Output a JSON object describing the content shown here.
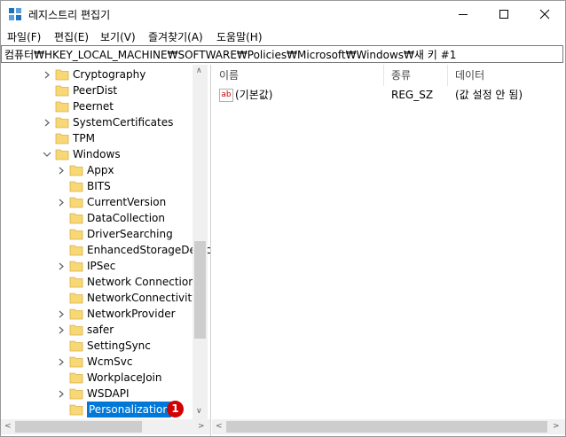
{
  "window": {
    "title": "레지스트리 편집기",
    "controls": [
      "minimize",
      "maximize",
      "close"
    ]
  },
  "menu": [
    {
      "label": "파일(F)"
    },
    {
      "label": "편집(E)"
    },
    {
      "label": "보기(V)"
    },
    {
      "label": "즐겨찾기(A)"
    },
    {
      "label": "도움말(H)"
    }
  ],
  "address": "컴퓨터₩HKEY_LOCAL_MACHINE₩SOFTWARE₩Policies₩Microsoft₩Windows₩새 키 #1",
  "tree": {
    "items": [
      {
        "label": "Cryptography",
        "level": 1,
        "expander": "collapsed"
      },
      {
        "label": "PeerDist",
        "level": 1,
        "expander": "none"
      },
      {
        "label": "Peernet",
        "level": 1,
        "expander": "none"
      },
      {
        "label": "SystemCertificates",
        "level": 1,
        "expander": "collapsed"
      },
      {
        "label": "TPM",
        "level": 1,
        "expander": "none"
      },
      {
        "label": "Windows",
        "level": 1,
        "expander": "expanded"
      },
      {
        "label": "Appx",
        "level": 2,
        "expander": "collapsed"
      },
      {
        "label": "BITS",
        "level": 2,
        "expander": "none"
      },
      {
        "label": "CurrentVersion",
        "level": 2,
        "expander": "collapsed"
      },
      {
        "label": "DataCollection",
        "level": 2,
        "expander": "none"
      },
      {
        "label": "DriverSearching",
        "level": 2,
        "expander": "none"
      },
      {
        "label": "EnhancedStorageDevic",
        "level": 2,
        "expander": "none"
      },
      {
        "label": "IPSec",
        "level": 2,
        "expander": "collapsed"
      },
      {
        "label": "Network Connections",
        "level": 2,
        "expander": "none"
      },
      {
        "label": "NetworkConnectivityS",
        "level": 2,
        "expander": "none"
      },
      {
        "label": "NetworkProvider",
        "level": 2,
        "expander": "collapsed"
      },
      {
        "label": "safer",
        "level": 2,
        "expander": "collapsed"
      },
      {
        "label": "SettingSync",
        "level": 2,
        "expander": "none"
      },
      {
        "label": "WcmSvc",
        "level": 2,
        "expander": "collapsed"
      },
      {
        "label": "WorkplaceJoin",
        "level": 2,
        "expander": "none"
      },
      {
        "label": "WSDAPI",
        "level": 2,
        "expander": "collapsed"
      },
      {
        "label": "Personalization",
        "level": 2,
        "expander": "none",
        "selected": true,
        "editing": true
      }
    ],
    "badge": "1"
  },
  "values": {
    "headers": {
      "name": "이름",
      "type": "종류",
      "data": "데이터"
    },
    "rows": [
      {
        "icon": "string-value-icon",
        "icon_text": "ab",
        "name": "(기본값)",
        "type": "REG_SZ",
        "data": "(값 설정 안 됨)"
      }
    ]
  },
  "colors": {
    "selection": "#0078d7",
    "folder": "#f8d775",
    "badge": "#d40000"
  }
}
